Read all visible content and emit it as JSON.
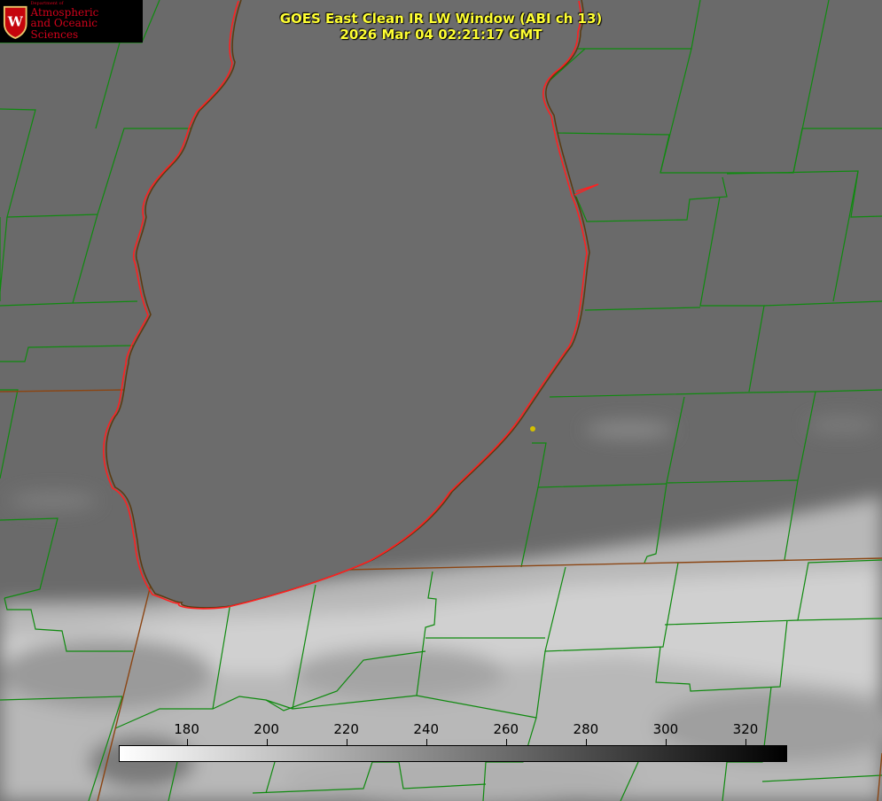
{
  "header": {
    "title": "GOES East Clean IR LW Window (ABI ch 13)",
    "timestamp": "2026 Mar 04 02:21:17 GMT"
  },
  "logo": {
    "dept": "Department of",
    "line1": "Atmospheric",
    "line2": "and Oceanic Sciences",
    "color": "#d0021b"
  },
  "colorbar": {
    "min": 163,
    "max": 330,
    "ticks": [
      "180",
      "200",
      "220",
      "240",
      "260",
      "280",
      "300",
      "320"
    ],
    "gradient_from": "#ffffff",
    "gradient_to": "#000000"
  },
  "map_colors": {
    "county_lines": "#0f8a0f",
    "lake_outline": "#ff2020",
    "state_lines": "#8b4513",
    "marker": "#d4c000",
    "cloud_gray": "#6b6b6b"
  }
}
